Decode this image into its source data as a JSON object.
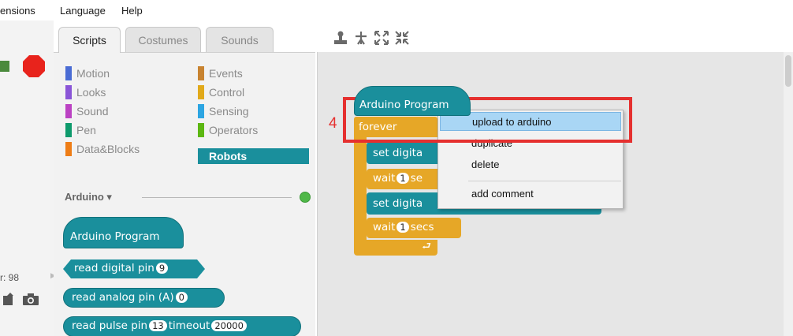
{
  "menubar": {
    "items": [
      "ensions",
      "Language",
      "Help"
    ]
  },
  "stage": {
    "coord_label": "r: 98"
  },
  "tabs": [
    "Scripts",
    "Costumes",
    "Sounds"
  ],
  "toolbar": {
    "icons": [
      "stamp-icon",
      "grow-icon",
      "expand-icon",
      "shrink-icon"
    ]
  },
  "categories": [
    {
      "label": "Motion",
      "color": "#4a6cd4"
    },
    {
      "label": "Looks",
      "color": "#8a55d7"
    },
    {
      "label": "Sound",
      "color": "#bb42c3"
    },
    {
      "label": "Pen",
      "color": "#0e9a6c"
    },
    {
      "label": "Data&Blocks",
      "color": "#ee7d16"
    },
    {
      "label": "Events",
      "color": "#c88330"
    },
    {
      "label": "Control",
      "color": "#e1a91a"
    },
    {
      "label": "Sensing",
      "color": "#2ca5e2"
    },
    {
      "label": "Operators",
      "color": "#5cb712"
    },
    {
      "label": "Robots",
      "color": "#1a8f9c"
    }
  ],
  "extension": {
    "header": "Arduino ▾"
  },
  "palette_blocks": {
    "arduino_program": "Arduino Program",
    "read_digital": {
      "text": "read digital pin",
      "arg": "9"
    },
    "read_analog": {
      "text": "read analog pin (A)",
      "arg": "0"
    },
    "read_pulse": {
      "text": "read pulse pin",
      "arg1": "13",
      "mid": "timeout",
      "arg2": "20000"
    }
  },
  "script": {
    "hat": "Arduino Program",
    "forever": "forever",
    "set1": "set digita",
    "wait1": {
      "text": "wait",
      "arg": "1",
      "unit": "se"
    },
    "set2": "set digita",
    "wait2": {
      "text": "wait",
      "arg": "1",
      "unit": "secs"
    },
    "loop_arrow": "⮐"
  },
  "context_menu": {
    "items": [
      "upload to arduino",
      "duplicate",
      "delete",
      "add comment"
    ],
    "highlighted": "upload to arduino"
  },
  "annotation": {
    "number": "4",
    "color": "#e5302f"
  }
}
